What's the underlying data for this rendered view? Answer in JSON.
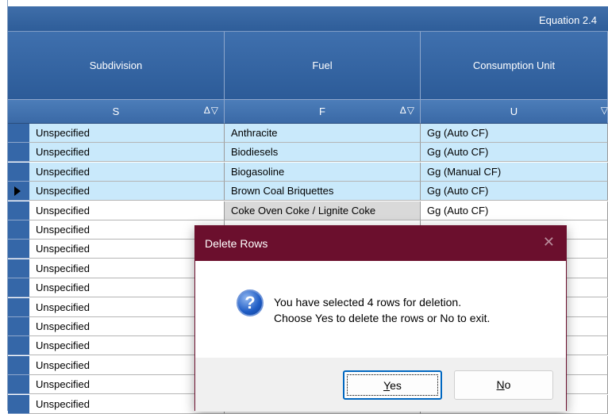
{
  "grid": {
    "band_title": "Equation 2.4",
    "columns": [
      {
        "header": "Subdivision",
        "code": "S",
        "filter": "Δ▽"
      },
      {
        "header": "Fuel",
        "code": "F",
        "filter": "Δ▽"
      },
      {
        "header": "Consumption Unit",
        "code": "U",
        "filter": "▽"
      }
    ],
    "rows": [
      {
        "subdivision": "Unspecified",
        "fuel": "Anthracite",
        "unit": "Gg (Auto CF)",
        "selected": true,
        "current": false
      },
      {
        "subdivision": "Unspecified",
        "fuel": "Biodiesels",
        "unit": "Gg (Auto CF)",
        "selected": true,
        "current": false
      },
      {
        "subdivision": "Unspecified",
        "fuel": "Biogasoline",
        "unit": "Gg (Manual CF)",
        "selected": true,
        "current": false
      },
      {
        "subdivision": "Unspecified",
        "fuel": "Brown Coal Briquettes",
        "unit": "Gg (Auto CF)",
        "selected": true,
        "current": true
      },
      {
        "subdivision": "Unspecified",
        "fuel": "Coke Oven Coke / Lignite Coke",
        "unit": "Gg (Auto CF)",
        "selected": false,
        "current": false
      },
      {
        "subdivision": "Unspecified",
        "fuel": "",
        "unit": "",
        "selected": false,
        "current": false
      },
      {
        "subdivision": "Unspecified",
        "fuel": "",
        "unit": "",
        "selected": false,
        "current": false
      },
      {
        "subdivision": "Unspecified",
        "fuel": "",
        "unit": "",
        "selected": false,
        "current": false
      },
      {
        "subdivision": "Unspecified",
        "fuel": "",
        "unit": "",
        "selected": false,
        "current": false
      },
      {
        "subdivision": "Unspecified",
        "fuel": "",
        "unit": "",
        "selected": false,
        "current": false
      },
      {
        "subdivision": "Unspecified",
        "fuel": "",
        "unit": "",
        "selected": false,
        "current": false
      },
      {
        "subdivision": "Unspecified",
        "fuel": "",
        "unit": "",
        "selected": false,
        "current": false
      },
      {
        "subdivision": "Unspecified",
        "fuel": "",
        "unit": "",
        "selected": false,
        "current": false
      },
      {
        "subdivision": "Unspecified",
        "fuel": "",
        "unit": "",
        "selected": false,
        "current": false
      },
      {
        "subdivision": "Unspecified",
        "fuel": "",
        "unit": "",
        "selected": false,
        "current": false
      }
    ]
  },
  "dialog": {
    "title": "Delete Rows",
    "close_glyph": "✕",
    "icon": "question-icon",
    "icon_glyph": "?",
    "message_line1": "You have selected 4 rows for deletion.",
    "message_line2": "Choose Yes to delete the rows or No to exit.",
    "yes_mnemonic": "Y",
    "yes_rest": "es",
    "no_mnemonic": "N",
    "no_rest": "o"
  },
  "colors": {
    "header_blue": "#2e5d99",
    "selected_row": "#c9e9fb",
    "dialog_title": "#6b0f2d",
    "focus_cell": "#d9d9d9"
  }
}
